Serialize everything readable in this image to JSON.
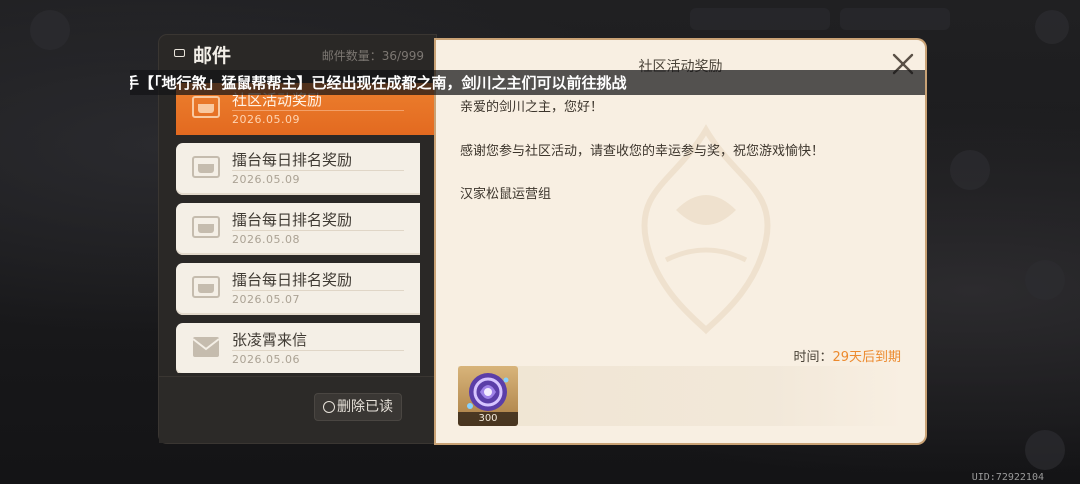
{
  "header": {
    "title": "邮件",
    "count_label": "邮件数量：36/999",
    "title_icon": "eye-icon"
  },
  "mail_list": [
    {
      "label": "社区活动奖励",
      "date": "2026.05.09",
      "selected": true,
      "icon": "mailbox-icon"
    },
    {
      "label": "擂台每日排名奖励",
      "date": "2026.05.09",
      "selected": false,
      "icon": "mailbox-icon"
    },
    {
      "label": "擂台每日排名奖励",
      "date": "2026.05.08",
      "selected": false,
      "icon": "mailbox-icon"
    },
    {
      "label": "擂台每日排名奖励",
      "date": "2026.05.07",
      "selected": false,
      "icon": "mailbox-icon"
    },
    {
      "label": "张凌霄来信",
      "date": "2026.05.06",
      "selected": false,
      "icon": "envelope-icon"
    }
  ],
  "footer": {
    "delete_read_label": "删除已读"
  },
  "detail": {
    "title": "社区活动奖励",
    "lines": [
      "亲爱的剑川之主，您好！",
      "感谢您参与社区活动，请查收您的幸运参与奖，祝您游戏愉快！",
      "汉家松鼠运营组"
    ],
    "expiry_label": "时间：",
    "expiry_value": "29天后到期",
    "attachments": [
      {
        "icon": "spirit-orb-icon",
        "qty": "300"
      }
    ]
  },
  "announcement": "手【「地行煞」猛鼠帮帮主】已经出现在成都之南，剑川之主们可以前往挑战",
  "uid": "UID:72922104",
  "colors": {
    "accent": "#e87428",
    "panel_bg": "#f8efe2",
    "list_bg": "#2a2826",
    "expiry": "#ec8a2e"
  }
}
